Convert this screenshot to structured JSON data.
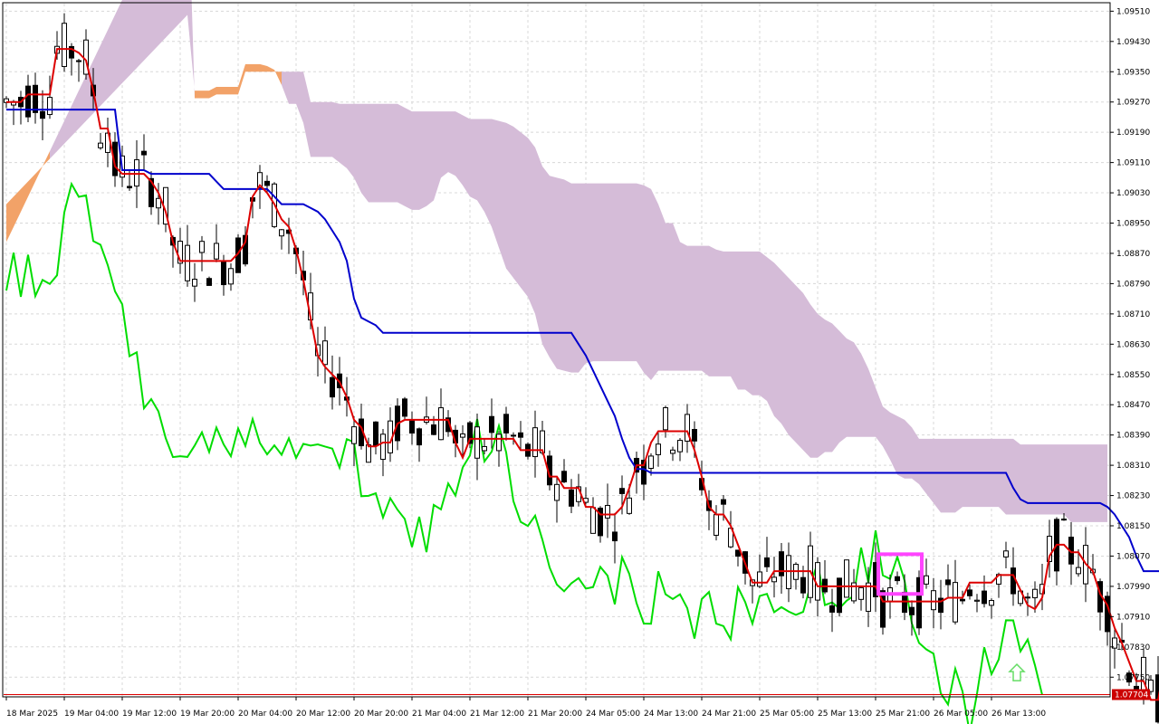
{
  "chart_data": {
    "type": "candlestick",
    "title": "",
    "price_scale": {
      "ticks": [
        1.0951,
        1.0943,
        1.0935,
        1.0927,
        1.0919,
        1.0911,
        1.0903,
        1.0895,
        1.0887,
        1.0879,
        1.0871,
        1.0863,
        1.0855,
        1.0847,
        1.0839,
        1.0831,
        1.0823,
        1.0815,
        1.0807,
        1.0799,
        1.0791,
        1.0783,
        1.0775
      ],
      "tick_labels": [
        "1.09510",
        "1.09430",
        "1.09350",
        "1.09270",
        "1.09190",
        "1.09110",
        "1.09030",
        "1.08950",
        "1.08870",
        "1.08790",
        "1.08710",
        "1.08630",
        "1.08550",
        "1.08470",
        "1.08390",
        "1.08310",
        "1.08230",
        "1.08150",
        "1.08070",
        "1.07990",
        "1.07910",
        "1.07830",
        "1.07750"
      ],
      "range": [
        1.07698,
        1.0953
      ],
      "current_price": 1.07704,
      "current_price_label": "1.07704"
    },
    "time_axis": {
      "labels": [
        "18 Mar 2025",
        "19 Mar 04:00",
        "19 Mar 12:00",
        "19 Mar 20:00",
        "20 Mar 04:00",
        "20 Mar 12:00",
        "20 Mar 20:00",
        "21 Mar 04:00",
        "21 Mar 12:00",
        "21 Mar 20:00",
        "24 Mar 05:00",
        "24 Mar 13:00",
        "24 Mar 21:00",
        "25 Mar 05:00",
        "25 Mar 13:00",
        "25 Mar 21:00",
        "26 Mar 05:00",
        "26 Mar 13:00"
      ],
      "label_every_bars": 8
    },
    "grid": true,
    "colors": {
      "bull_body": "#ffffff",
      "bear_body": "#000000",
      "wick": "#000000",
      "tenkan": "#dd0000",
      "kijun": "#0000cc",
      "chikou": "#00dd00",
      "cloud_bull": "#f2a268",
      "cloud_bear": "#d5bcd8",
      "current_price_line": "#dd0000",
      "current_price_box": "#cc0000",
      "marker_box": "#ff44ff",
      "arrow": "#66dd66",
      "grid": "#d8d8d8"
    },
    "ichimoku": {
      "tenkan": [
        1.0927,
        1.0927,
        1.0927,
        1.0929,
        1.0929,
        1.0929,
        1.0929,
        1.0941,
        1.0941,
        1.0941,
        1.094,
        1.0938,
        1.093,
        1.092,
        1.092,
        1.091,
        1.0908,
        1.0908,
        1.0908,
        1.0908,
        1.0906,
        1.0903,
        1.0898,
        1.089,
        1.0885,
        1.0885,
        1.0885,
        1.0885,
        1.0885,
        1.0885,
        1.0885,
        1.0885,
        1.0887,
        1.089,
        1.0902,
        1.0905,
        1.0903,
        1.09,
        1.0896,
        1.0894,
        1.0888,
        1.088,
        1.087,
        1.086,
        1.0857,
        1.0855,
        1.0853,
        1.0849,
        1.0843,
        1.0841,
        1.0836,
        1.0836,
        1.0837,
        1.0837,
        1.0842,
        1.0843,
        1.0843,
        1.0843,
        1.0843,
        1.0843,
        1.0843,
        1.0843,
        1.0837,
        1.0833,
        1.0838,
        1.0838,
        1.0838,
        1.0838,
        1.0838,
        1.0838,
        1.0838,
        1.0835,
        1.0835,
        1.0835,
        1.0835,
        1.0828,
        1.0828,
        1.0825,
        1.0825,
        1.0825,
        1.082,
        1.082,
        1.0818,
        1.0818,
        1.0818,
        1.082,
        1.0825,
        1.0831,
        1.0831,
        1.0837,
        1.084,
        1.084,
        1.084,
        1.084,
        1.084,
        1.0835,
        1.0828,
        1.082,
        1.0818,
        1.0818,
        1.0815,
        1.081,
        1.0805,
        1.08,
        1.08,
        1.08,
        1.0803,
        1.0803,
        1.0803,
        1.0803,
        1.0803,
        1.0803,
        1.0799,
        1.0799,
        1.0799,
        1.0799,
        1.0799,
        1.0799,
        1.0799,
        1.0799,
        1.0799,
        1.0795,
        1.0795,
        1.0795,
        1.0795,
        1.0795,
        1.0795,
        1.0795,
        1.0795,
        1.0795,
        1.0796,
        1.0796,
        1.0796,
        1.08,
        1.08,
        1.08,
        1.08,
        1.0802,
        1.0802,
        1.0802,
        1.0798,
        1.0794,
        1.0793,
        1.0796,
        1.0807,
        1.081,
        1.081,
        1.0808,
        1.0808,
        1.0805,
        1.0803,
        1.0797,
        1.0794,
        1.0788,
        1.0784,
        1.0779,
        1.0774,
        1.0774,
        1.0769,
        1.0769,
        1.0779,
        1.078,
        1.078,
        1.078,
        1.0787,
        1.0787,
        1.0787,
        1.0787,
        1.0784,
        1.077
      ],
      "kijun": [
        1.0925,
        1.0925,
        1.0925,
        1.0925,
        1.0925,
        1.0925,
        1.0925,
        1.0925,
        1.0925,
        1.0925,
        1.0925,
        1.0925,
        1.0925,
        1.0925,
        1.0925,
        1.0925,
        1.0909,
        1.0909,
        1.0909,
        1.0909,
        1.0908,
        1.0908,
        1.0908,
        1.0908,
        1.0908,
        1.0908,
        1.0908,
        1.0908,
        1.0908,
        1.0906,
        1.0904,
        1.0904,
        1.0904,
        1.0904,
        1.0904,
        1.0904,
        1.0904,
        1.0902,
        1.09,
        1.09,
        1.09,
        1.09,
        1.0899,
        1.0898,
        1.0896,
        1.0893,
        1.089,
        1.0885,
        1.0875,
        1.087,
        1.0869,
        1.0868,
        1.0866,
        1.0866,
        1.0866,
        1.0866,
        1.0866,
        1.0866,
        1.0866,
        1.0866,
        1.0866,
        1.0866,
        1.0866,
        1.0866,
        1.0866,
        1.0866,
        1.0866,
        1.0866,
        1.0866,
        1.0866,
        1.0866,
        1.0866,
        1.0866,
        1.0866,
        1.0866,
        1.0866,
        1.0866,
        1.0866,
        1.0866,
        1.0863,
        1.086,
        1.0856,
        1.0852,
        1.0848,
        1.0844,
        1.0838,
        1.0833,
        1.083,
        1.083,
        1.0829,
        1.0829,
        1.0829,
        1.0829,
        1.0829,
        1.0829,
        1.0829,
        1.0829,
        1.0829,
        1.0829,
        1.0829,
        1.0829,
        1.0829,
        1.0829,
        1.0829,
        1.0829,
        1.0829,
        1.0829,
        1.0829,
        1.0829,
        1.0829,
        1.0829,
        1.0829,
        1.0829,
        1.0829,
        1.0829,
        1.0829,
        1.0829,
        1.0829,
        1.0829,
        1.0829,
        1.0829,
        1.0829,
        1.0829,
        1.0829,
        1.0829,
        1.0829,
        1.0829,
        1.0829,
        1.0829,
        1.0829,
        1.0829,
        1.0829,
        1.0829,
        1.0829,
        1.0829,
        1.0829,
        1.0829,
        1.0829,
        1.0829,
        1.0825,
        1.0822,
        1.0821,
        1.0821,
        1.0821,
        1.0821,
        1.0821,
        1.0821,
        1.0821,
        1.0821,
        1.0821,
        1.0821,
        1.0821,
        1.082,
        1.0818,
        1.0815,
        1.0812,
        1.0807,
        1.0803,
        1.0803,
        1.0803,
        1.0803,
        1.0803,
        1.0803,
        1.0803,
        1.0803,
        1.0803,
        1.0803,
        1.0803,
        1.0803,
        1.0803,
        1.0803,
        1.0803,
        1.0803,
        1.0803,
        1.0803,
        1.0803,
        1.0803,
        1.0803,
        1.0803,
        1.0803,
        1.0803,
        1.0803,
        1.0803,
        1.0803,
        1.08,
        1.0798
      ]
    },
    "marker_box_price_range": [
      1.0797,
      1.08075
    ],
    "arrow_price": 1.0776
  }
}
